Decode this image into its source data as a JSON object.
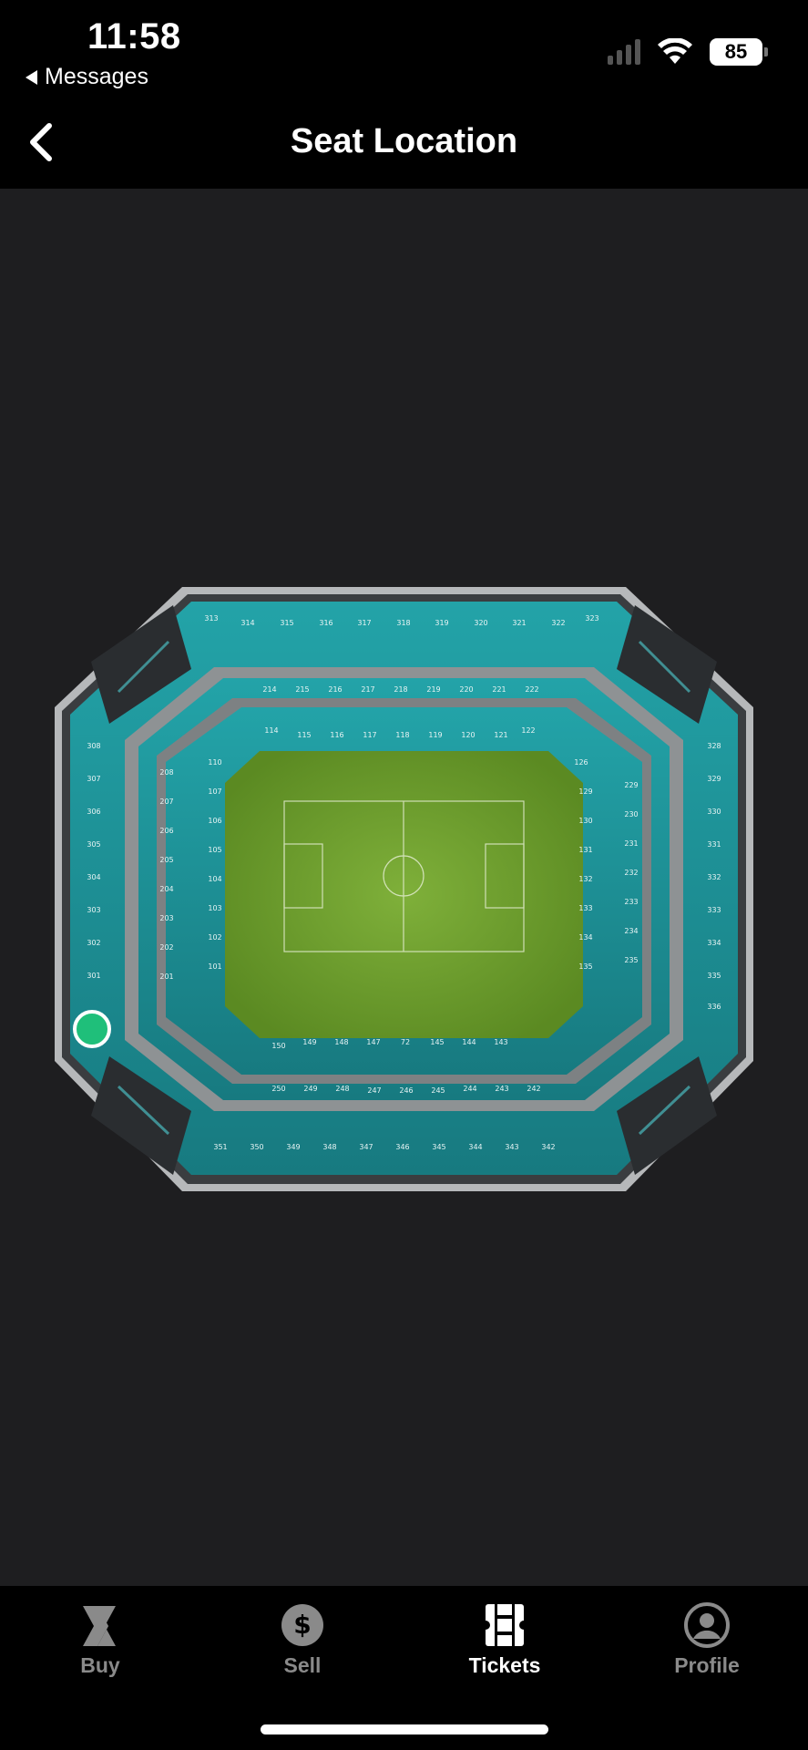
{
  "status_bar": {
    "time": "11:58",
    "back_app": "Messages",
    "battery": "85"
  },
  "header": {
    "title": "Seat Location"
  },
  "map": {
    "sections_top_300": [
      "313",
      "314",
      "315",
      "316",
      "317",
      "318",
      "319",
      "320",
      "321",
      "322",
      "323"
    ],
    "sections_top_200": [
      "214",
      "215",
      "216",
      "217",
      "218",
      "219",
      "220",
      "221",
      "222"
    ],
    "sections_top_100": [
      "114",
      "115",
      "116",
      "117",
      "118",
      "119",
      "120",
      "121",
      "122"
    ],
    "sections_left_300": [
      "308",
      "307",
      "306",
      "305",
      "304",
      "303",
      "302",
      "301"
    ],
    "sections_left_200": [
      "208",
      "207",
      "206",
      "205",
      "204",
      "203",
      "202",
      "201"
    ],
    "sections_left_100": [
      "110",
      "107",
      "106",
      "105",
      "104",
      "103",
      "102",
      "101"
    ],
    "sections_right_300": [
      "328",
      "329",
      "330",
      "331",
      "332",
      "333",
      "334",
      "335",
      "336"
    ],
    "sections_right_200": [
      "229",
      "230",
      "231",
      "232",
      "233",
      "234",
      "235"
    ],
    "sections_right_100": [
      "126",
      "129",
      "130",
      "131",
      "132",
      "133",
      "134",
      "135"
    ],
    "sections_bottom_100": [
      "150",
      "149",
      "148",
      "147",
      "72",
      "145",
      "144",
      "143"
    ],
    "sections_bottom_200": [
      "250",
      "249",
      "248",
      "247",
      "246",
      "245",
      "244",
      "243",
      "242"
    ],
    "sections_bottom_300": [
      "351",
      "350",
      "349",
      "348",
      "347",
      "346",
      "345",
      "344",
      "343",
      "342"
    ],
    "colors": {
      "seat_teal": "#1e8f95",
      "concourse": "#8e9294",
      "pitch": "#6f9e2c",
      "marker": "#1fbf7a"
    }
  },
  "tabs": [
    {
      "label": "Buy",
      "icon": "buy-chevron-icon"
    },
    {
      "label": "Sell",
      "icon": "dollar-coin-icon"
    },
    {
      "label": "Tickets",
      "icon": "ticket-icon"
    },
    {
      "label": "Profile",
      "icon": "profile-icon"
    }
  ]
}
